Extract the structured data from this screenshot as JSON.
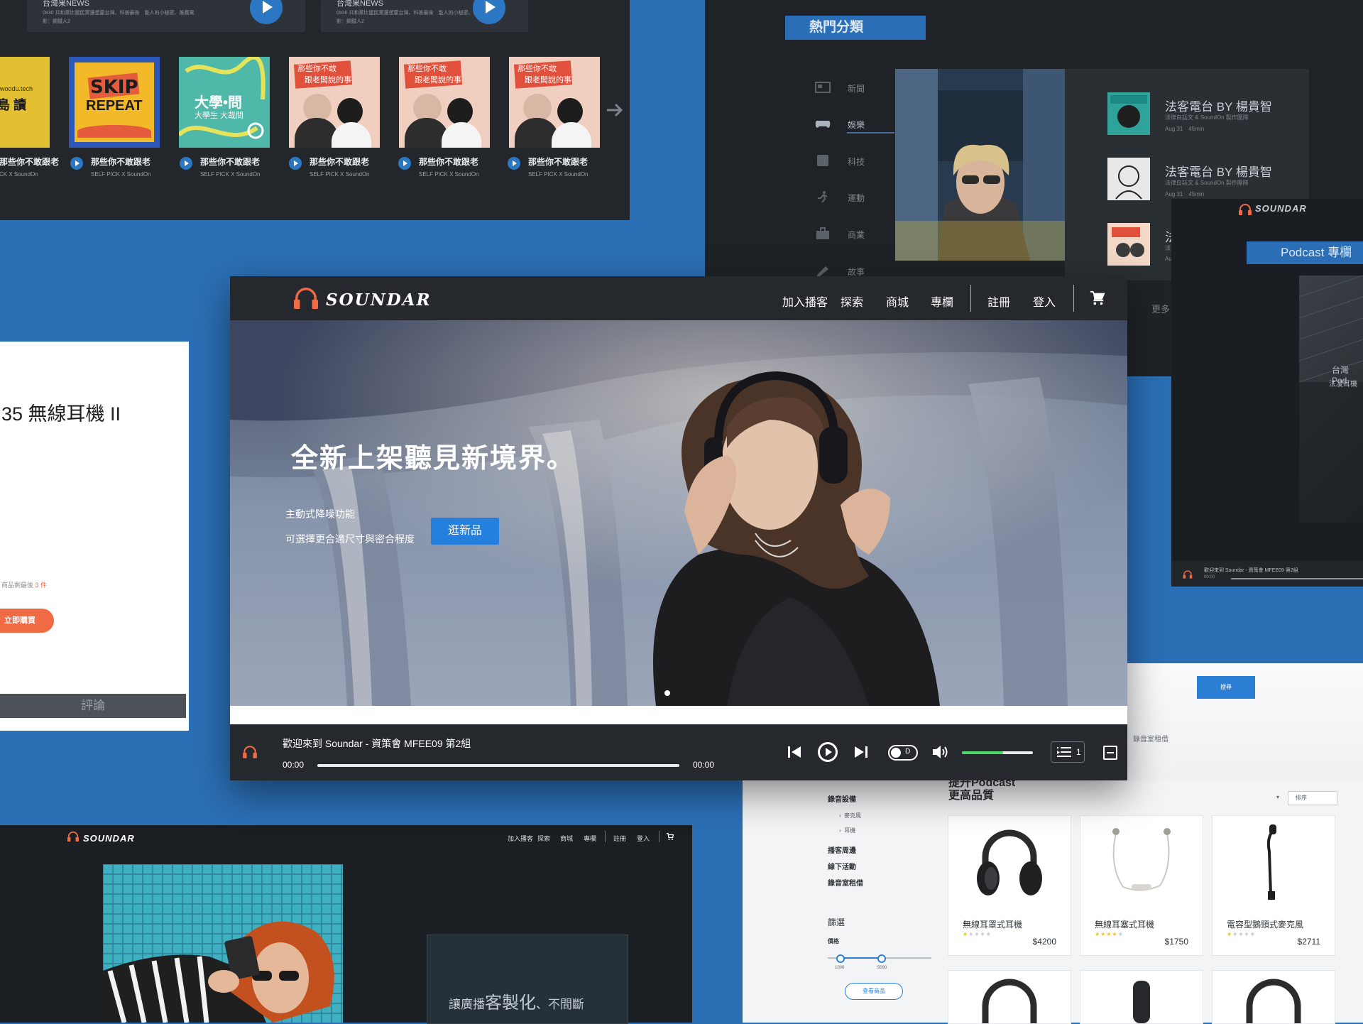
{
  "brand": {
    "name": "SOUNDAR",
    "accent": "#f06a44",
    "primary": "#2480dc",
    "dark": "#25282c"
  },
  "background_panels": {
    "podcast_list": {
      "news_cards": [
        {
          "title": "台灣果NEWS",
          "desc": "0830 共和黨比國民黨還想要台灣、科普最後　能人的小秘密、推薦電影：鋼鐵人2"
        },
        {
          "title": "台灣果NEWS",
          "desc": "0830 共和黨比國民黨還想要台灣、科普最後　能人的小秘密、推薦電影：鋼鐵人2"
        }
      ],
      "covers": [
        {
          "title": "那些你不敢跟老",
          "sub": "CK X SoundOn",
          "art": "yellow",
          "art_text1": "woodu.tech",
          "art_text2": "島 讀"
        },
        {
          "title": "那些你不敢跟老",
          "sub": "SELF PICK X SoundOn",
          "art": "skip",
          "art_text1": "SKIP",
          "art_text2": "REPEAT"
        },
        {
          "title": "那些你不敢跟老",
          "sub": "SELF PICK X SoundOn",
          "art": "green",
          "art_text1": "大學•問",
          "art_text2": "大學生 大哉問"
        },
        {
          "title": "那些你不敢跟老",
          "sub": "SELF PICK X SoundOn",
          "art": "pink",
          "art_text1": "那些你不敢",
          "art_text2": "跟老闆說的事"
        },
        {
          "title": "那些你不敢跟老",
          "sub": "SELF PICK X SoundOn",
          "art": "pink",
          "art_text1": "那些你不敢",
          "art_text2": "跟老闆說的事"
        },
        {
          "title": "那些你不敢跟老",
          "sub": "SELF PICK X SoundOn",
          "art": "pink",
          "art_text1": "那些你不敢",
          "art_text2": "跟老闆說的事"
        }
      ]
    },
    "categories_panel": {
      "hot_label": "熱門分類",
      "categories": [
        {
          "label": "新聞",
          "icon": "newspaper-icon"
        },
        {
          "label": "娛樂",
          "icon": "gamepad-icon",
          "active": true
        },
        {
          "label": "科技",
          "icon": "device-icon"
        },
        {
          "label": "運動",
          "icon": "running-icon"
        },
        {
          "label": "商業",
          "icon": "briefcase-icon"
        },
        {
          "label": "故事",
          "icon": "pen-icon"
        }
      ],
      "podcasts": [
        {
          "title": "法客電台 BY 楊貴智",
          "sub": "法律白話文 & SoundOn 製作團隊",
          "meta": "Aug 31　45min"
        },
        {
          "title": "法客電台 BY 楊貴智",
          "sub": "法律白話文 & SoundOn 製作團隊",
          "meta": "Aug 31　45min"
        },
        {
          "title": "法",
          "sub": "法",
          "meta": "Au"
        }
      ],
      "more": "更多"
    },
    "column_window": {
      "logo": "SOUNDAR",
      "button": "Podcast 專欄",
      "image_text": "台灣Pod",
      "image_text2": "法凌耳機",
      "player_text": "歡迎來到 Soundar - 資策會 MFEE09 第2組",
      "player_time": "00:00"
    },
    "product_card": {
      "title": "35 無線耳機 II",
      "stock_prefix": "商品剩最後 ",
      "stock_count": "3 件",
      "buy_label": "立即購買",
      "tab_label": "評論"
    },
    "dark_page": {
      "logo": "SOUNDAR",
      "menu": [
        "加入播客",
        "探索",
        "商城",
        "專欄",
        "註冊",
        "登入"
      ],
      "tagline_small1": "讓廣播",
      "tagline_big": "客製化",
      "tagline_small2": "、不間斷"
    },
    "shop_page": {
      "search_button": "搜尋",
      "label_left": "動",
      "label_right": "錄音室租借",
      "headline1": "提升Podcast",
      "headline2": "更高品質",
      "sort_label": "排序",
      "sidebar": {
        "h1": "錄音設備",
        "sub": [
          "麥克風",
          "耳機"
        ],
        "h2": "播客周邊",
        "h3": "線下活動",
        "h4": "錄音室租借",
        "filter": "篩選",
        "price": "價格",
        "price_min": "1000",
        "price_max": "5000",
        "check_btn": "查看商品"
      },
      "products": [
        {
          "name": "無線耳罩式耳機",
          "price": "$4200",
          "stars": 1
        },
        {
          "name": "無線耳塞式耳機",
          "price": "$1750",
          "stars": 4
        },
        {
          "name": "電容型鵝頸式麥克風",
          "price": "$2711",
          "stars": 1
        }
      ]
    }
  },
  "main": {
    "nav": {
      "logo": "SOUNDAR",
      "items": [
        "加入播客",
        "探索",
        "商城",
        "專欄",
        "註冊",
        "登入"
      ]
    },
    "hero": {
      "headline": "全新上架聽見新境界。",
      "line1": "主動式降噪功能",
      "line2": "可選擇更合適尺寸與密合程度",
      "cta": "逛新品"
    },
    "player": {
      "now_playing": "歡迎來到 Soundar - 資策會 MFEE09 第2組",
      "time_current": "00:00",
      "time_total": "00:00",
      "progress": 0,
      "toggle_label": "D",
      "volume": 0.58,
      "queue_count": "1"
    }
  }
}
